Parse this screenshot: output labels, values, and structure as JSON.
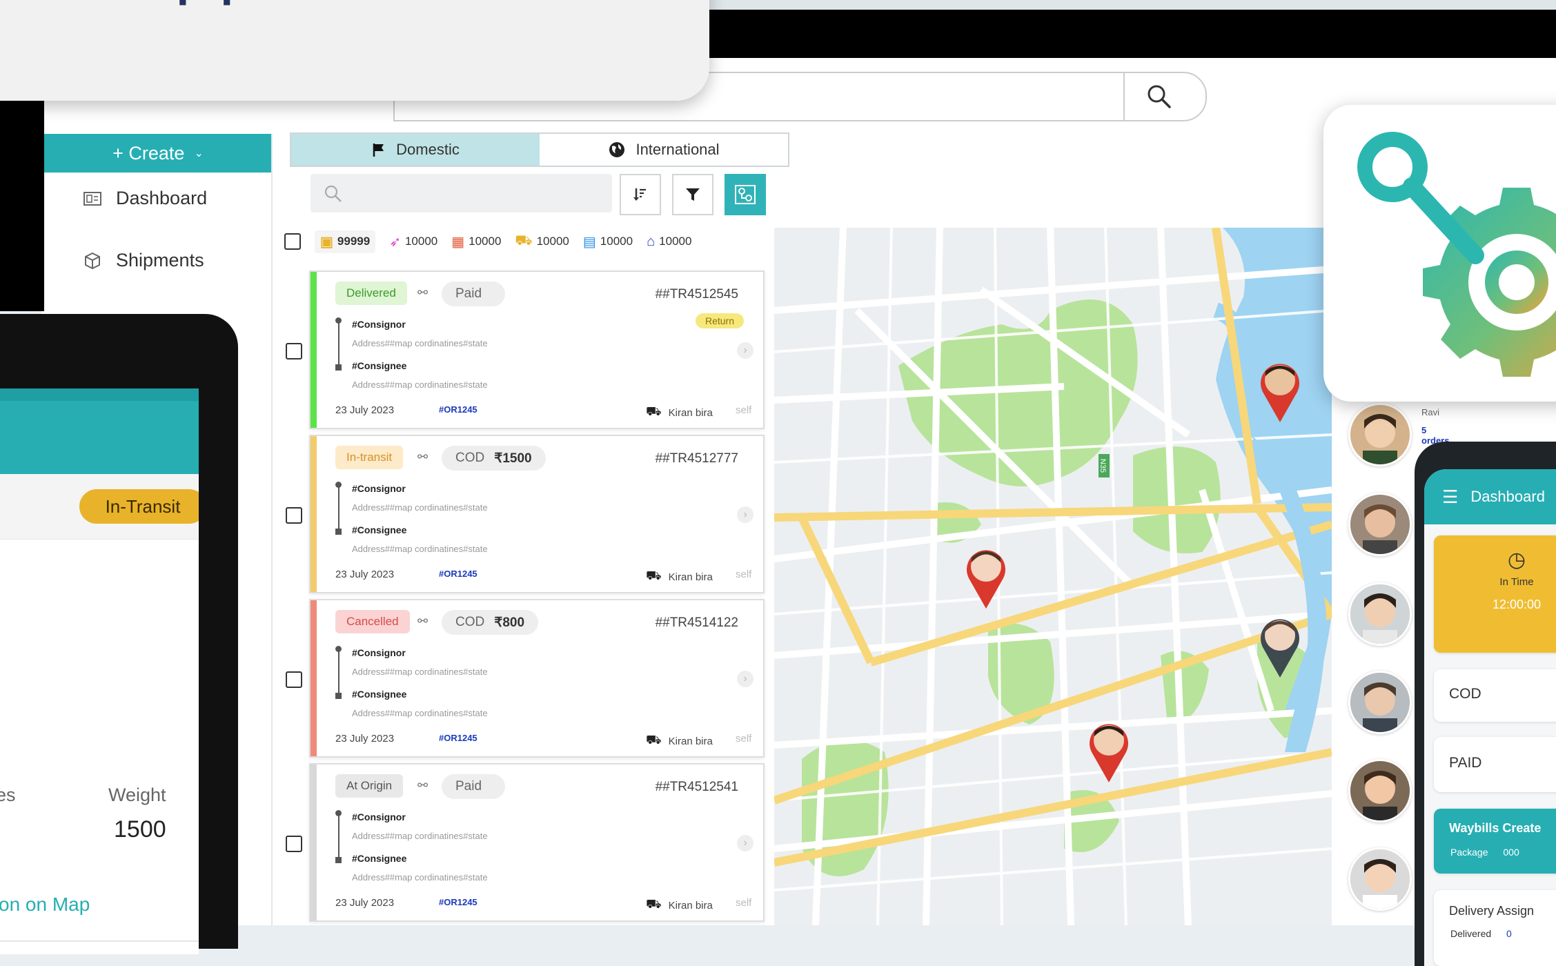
{
  "banner": {
    "heading_fragment": "own Apps"
  },
  "search": {
    "placeholder": ""
  },
  "sidebar": {
    "create_label": "+ Create",
    "items": [
      {
        "label": "Dashboard",
        "icon": "dashboard-icon"
      },
      {
        "label": "Shipments",
        "icon": "box-icon"
      }
    ]
  },
  "tabs": [
    {
      "label": "Domestic",
      "icon": "flag-icon",
      "active": true
    },
    {
      "label": "International",
      "icon": "globe-icon",
      "active": false
    }
  ],
  "counts": [
    {
      "icon": "box-icon",
      "value": "99999",
      "color": "#e8b32a"
    },
    {
      "icon": "rocket-icon",
      "value": "10000",
      "color": "#e23ccf"
    },
    {
      "icon": "warehouse-icon",
      "value": "10000",
      "color": "#e25b3a"
    },
    {
      "icon": "truck-icon",
      "value": "10000",
      "color": "#e8b32a"
    },
    {
      "icon": "handover-icon",
      "value": "10000",
      "color": "#2a8ee8"
    },
    {
      "icon": "home-icon",
      "value": "10000",
      "color": "#1f3fbf"
    }
  ],
  "shipments": [
    {
      "status": "Delivered",
      "status_bg": "#dff5d4",
      "status_color": "#3a9b2a",
      "stripe": "#5be34a",
      "payment": "Paid",
      "amount": "",
      "tracking": "##TR4512545",
      "return_label": "Return",
      "consignor": "#Consignor",
      "consignor_addr": "Address##map cordinatines#state",
      "consignee": "#Consignee",
      "consignee_addr": "Address##map cordinatines#state",
      "date": "23 July 2023",
      "order": "#OR1245",
      "driver": "Kiran bira",
      "driver_tag": "self"
    },
    {
      "status": "In-transit",
      "status_bg": "#fdeac8",
      "status_color": "#d4912a",
      "stripe": "#f1cc6e",
      "payment": "COD",
      "amount": "₹1500",
      "tracking": "##TR4512777",
      "return_label": "",
      "consignor": "#Consignor",
      "consignor_addr": "Address##map cordinatines#state",
      "consignee": "#Consignee",
      "consignee_addr": "Address##map cordinatines#state",
      "date": "23 July 2023",
      "order": "#OR1245",
      "driver": "Kiran bira",
      "driver_tag": "self"
    },
    {
      "status": "Cancelled",
      "status_bg": "#fbd3d3",
      "status_color": "#d64a4a",
      "stripe": "#ef8a7a",
      "payment": "COD",
      "amount": "₹800",
      "tracking": "##TR4514122",
      "return_label": "",
      "consignor": "#Consignor",
      "consignor_addr": "Address##map cordinatines#state",
      "consignee": "#Consignee",
      "consignee_addr": "Address##map cordinatines#state",
      "date": "23 July 2023",
      "order": "#OR1245",
      "driver": "Kiran bira",
      "driver_tag": "self"
    },
    {
      "status": "At Origin",
      "status_bg": "#e8e8e8",
      "status_color": "#555555",
      "stripe": "#d8d8d8",
      "payment": "Paid",
      "amount": "",
      "tracking": "##TR4512541",
      "return_label": "",
      "consignor": "#Consignor",
      "consignor_addr": "Address##map cordinatines#state",
      "consignee": "#Consignee",
      "consignee_addr": "Address##map cordinatines#state",
      "date": "23 July 2023",
      "order": "#OR1245",
      "driver": "Kiran bira",
      "driver_tag": "self"
    }
  ],
  "map": {
    "road_label": "N35"
  },
  "drivers": {
    "first_name": "Ravi",
    "first_orders": "5 orders"
  },
  "phone": {
    "title": "Dashboard",
    "timer_label": "In Time",
    "timer_value": "12:00:00",
    "cod_label": "COD",
    "paid_label": "PAID",
    "waybills_label": "Waybills Create",
    "package_label": "Package",
    "package_value": "000",
    "delivery_label": "Delivery Assign",
    "delivered_label": "Delivered",
    "delivered_value": "0"
  },
  "tablet": {
    "status_badge": "In-Transit",
    "col_left_fragment": "es",
    "weight_label": "Weight",
    "weight_value": "1500",
    "map_link_fragment": "on on Map"
  },
  "colors": {
    "accent": "#26aeb3",
    "brand_navy": "#26325f",
    "badge_yellow": "#e8b32a"
  }
}
